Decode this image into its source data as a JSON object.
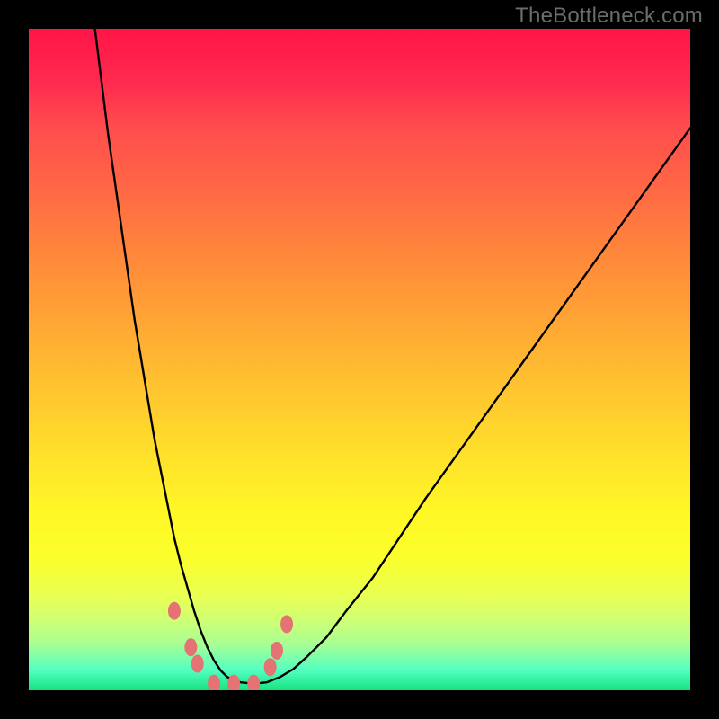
{
  "watermark": "TheBottleneck.com",
  "colors": {
    "frame": "#000000",
    "gradient_top": "#ff1547",
    "gradient_bottom": "#19e37f",
    "curve": "#000000",
    "marker_fill": "#e57373",
    "marker_stroke": "#cf5a5a"
  },
  "chart_data": {
    "type": "line",
    "title": "",
    "xlabel": "",
    "ylabel": "",
    "xlim": [
      0,
      100
    ],
    "ylim": [
      0,
      100
    ],
    "grid": false,
    "x": [
      10,
      11,
      12,
      13,
      14,
      15,
      16,
      17,
      18,
      19,
      20,
      21,
      22,
      23,
      24,
      25,
      26,
      27,
      28,
      29,
      30,
      32,
      34,
      36,
      38,
      40,
      42,
      45,
      48,
      52,
      56,
      60,
      65,
      70,
      75,
      80,
      85,
      90,
      95,
      100
    ],
    "values": [
      100,
      92,
      84,
      77,
      70,
      63,
      56,
      50,
      44,
      38,
      33,
      28,
      23,
      19,
      15.5,
      12,
      9,
      6.5,
      4.5,
      3,
      2,
      1.2,
      1,
      1.2,
      2,
      3.2,
      5,
      8,
      12,
      17,
      23,
      29,
      36,
      43,
      50,
      57,
      64,
      71,
      78,
      85
    ],
    "notch_markers": [
      {
        "x": 22,
        "y": 12
      },
      {
        "x": 24.5,
        "y": 6.5
      },
      {
        "x": 25.5,
        "y": 4
      },
      {
        "x": 28,
        "y": 1
      },
      {
        "x": 31,
        "y": 1
      },
      {
        "x": 34,
        "y": 1
      },
      {
        "x": 36.5,
        "y": 3.5
      },
      {
        "x": 37.5,
        "y": 6
      },
      {
        "x": 39,
        "y": 10
      }
    ]
  }
}
